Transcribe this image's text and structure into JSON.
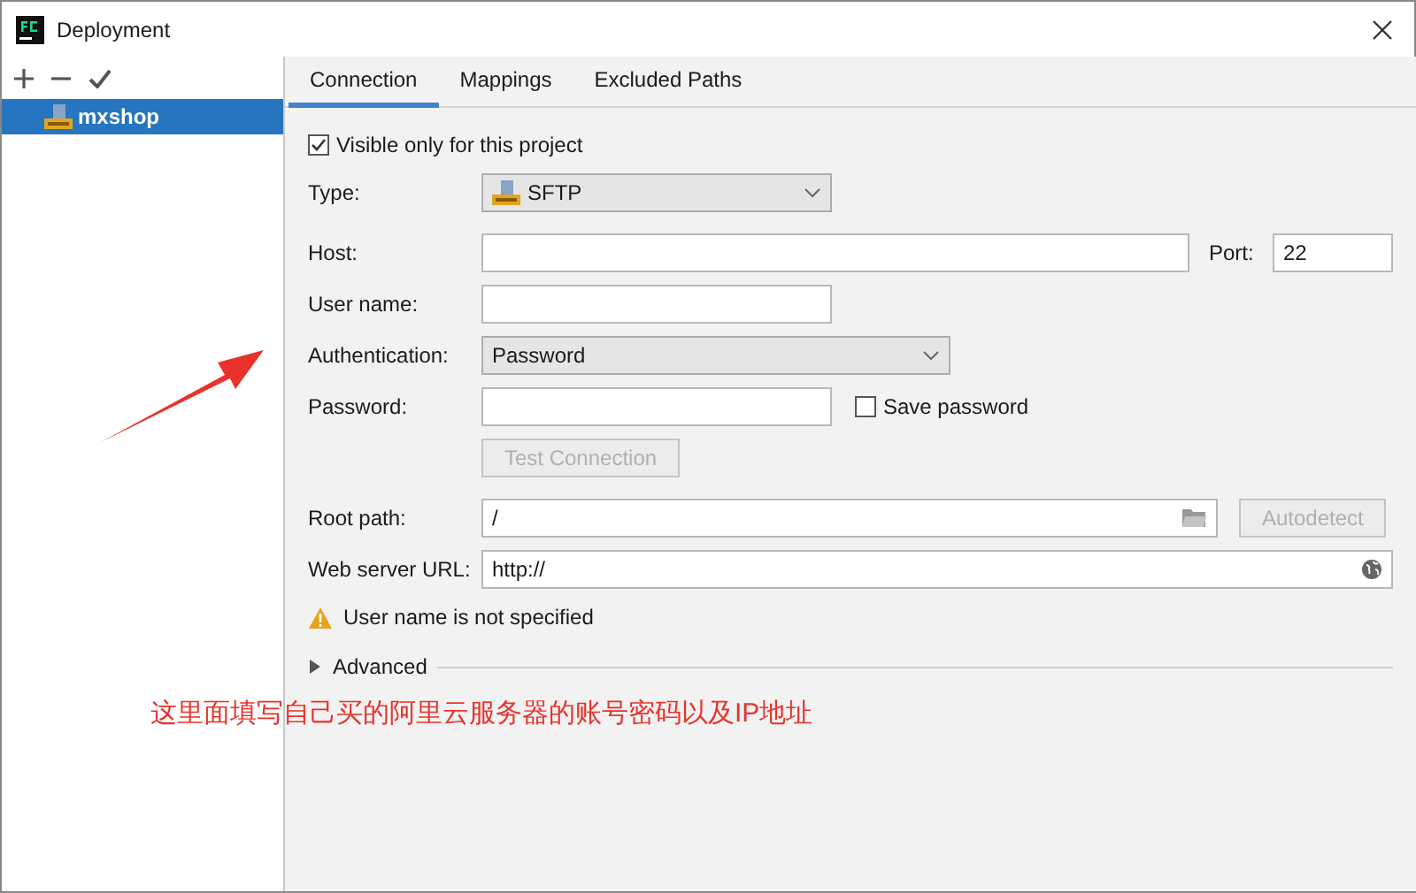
{
  "window": {
    "title": "Deployment"
  },
  "sidebar": {
    "items": [
      {
        "label": "mxshop",
        "selected": true
      }
    ]
  },
  "tabs": [
    {
      "label": "Connection",
      "selected": true
    },
    {
      "label": "Mappings",
      "selected": false
    },
    {
      "label": "Excluded Paths",
      "selected": false
    }
  ],
  "form": {
    "visible_only": {
      "label": "Visible only for this project",
      "checked": true
    },
    "type": {
      "label": "Type:",
      "value": "SFTP"
    },
    "host": {
      "label": "Host:"
    },
    "port": {
      "label": "Port:",
      "value": "22"
    },
    "user_name": {
      "label": "User name:"
    },
    "authentication": {
      "label": "Authentication:",
      "value": "Password"
    },
    "password": {
      "label": "Password:"
    },
    "save_password": {
      "label": "Save password",
      "checked": false
    },
    "test_connection": {
      "label": "Test Connection",
      "disabled": true
    },
    "root_path": {
      "label": "Root path:",
      "value": "/"
    },
    "autodetect": {
      "label": "Autodetect",
      "disabled": true
    },
    "web_server_url": {
      "label": "Web server URL:",
      "value": "http://"
    },
    "warning": "User name is not specified",
    "advanced": {
      "label": "Advanced",
      "expanded": false
    }
  },
  "annotation": {
    "text": "这里面填写自己买的阿里云服务器的账号密码以及IP地址"
  }
}
